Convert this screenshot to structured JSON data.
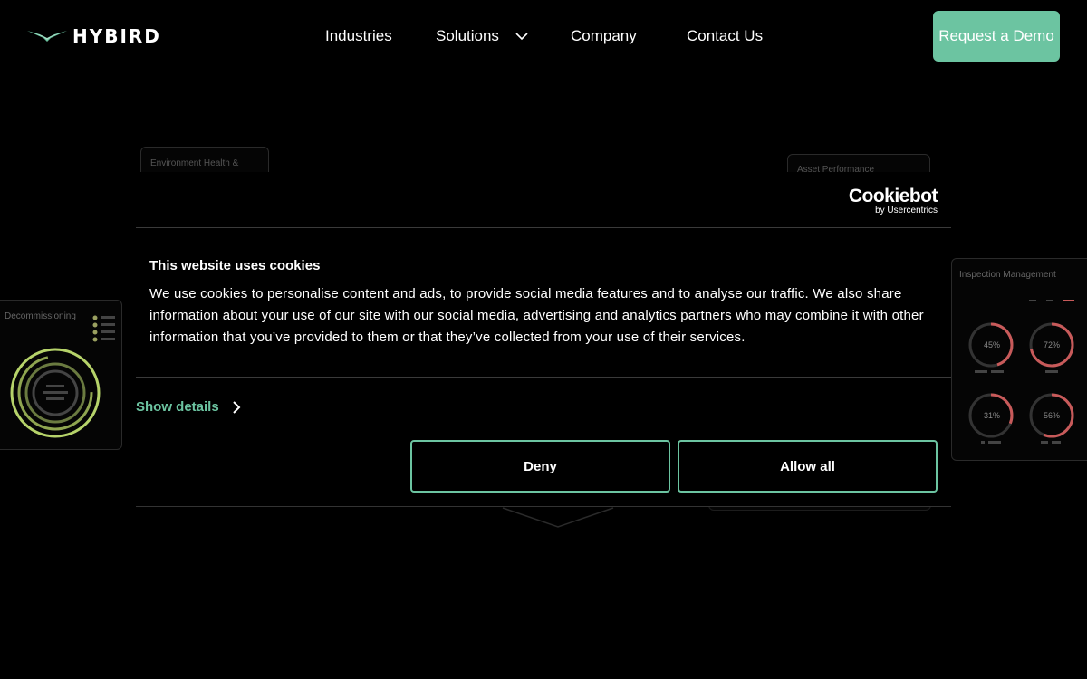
{
  "nav": {
    "logo_text": "HYBIRD",
    "links": [
      "Industries",
      "Solutions",
      "Company",
      "Contact Us"
    ],
    "demo_label": "Request a Demo"
  },
  "background": {
    "env_label": "Environment Health &",
    "asset_label": "Asset Performance",
    "decom_label": "Decommissioning",
    "inspect_label": "Inspection Management",
    "gauges": [
      "45%",
      "72%",
      "31%",
      "56%"
    ]
  },
  "cookie": {
    "brand": "Cookiebot",
    "brand_sub": "by Usercentrics",
    "title": "This website uses cookies",
    "text": "We use cookies to personalise content and ads, to provide social media features and to analyse our traffic. We also share information about your use of our site with our social media, advertising and analytics partners who may combine it with other information that you’ve provided to them or that they’ve collected from your use of their services.",
    "show_details": "Show details",
    "deny": "Deny",
    "allow_all": "Allow all"
  },
  "colors": {
    "accent": "#6cc4a1",
    "gauge_red": "#c85a5a",
    "ring_green": "#b6d36a"
  }
}
